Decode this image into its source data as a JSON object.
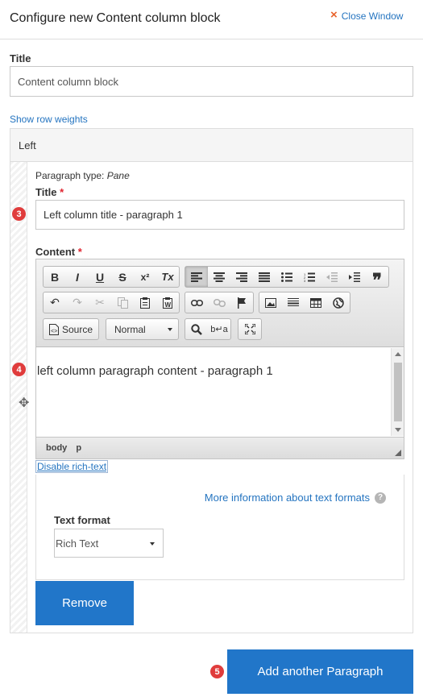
{
  "header": {
    "title": "Configure new Content column block",
    "close_label": "Close Window",
    "close_icon": "×"
  },
  "form": {
    "title_label": "Title",
    "title_value": "Content column block",
    "show_row_weights": "Show row weights"
  },
  "left": {
    "heading": "Left",
    "paragraph_type_prefix": "Paragraph type:",
    "paragraph_type": "Pane",
    "title_label": "Title",
    "title_value": "Left column title - paragraph 1",
    "content_label": "Content",
    "required_mark": "*",
    "body_text": "left column paragraph content - paragraph 1",
    "disable_rich_text": "Disable rich-text",
    "more_info": "More information about text formats",
    "help_glyph": "?",
    "text_format_label": "Text format",
    "text_format_value": "Rich Text",
    "remove_label": "Remove"
  },
  "editor": {
    "source_label": "Source",
    "format_value": "Normal",
    "path": [
      "body",
      "p"
    ],
    "row1_a": [
      "B",
      "I",
      "U",
      "S",
      "x²",
      "Tx"
    ],
    "row1_b": [
      "≡L",
      "≡C",
      "≡R",
      "≡J",
      "•≡",
      "1≡",
      "⇤",
      "⇥",
      "❞"
    ]
  },
  "badges": {
    "n3": "3",
    "n4": "4",
    "n5": "5"
  },
  "footer": {
    "add_label": "Add another Paragraph"
  },
  "colors": {
    "accent_blue": "#2176c9",
    "link_blue": "#2474c0",
    "badge_red": "#e03c3c",
    "close_orange": "#e8622b"
  }
}
